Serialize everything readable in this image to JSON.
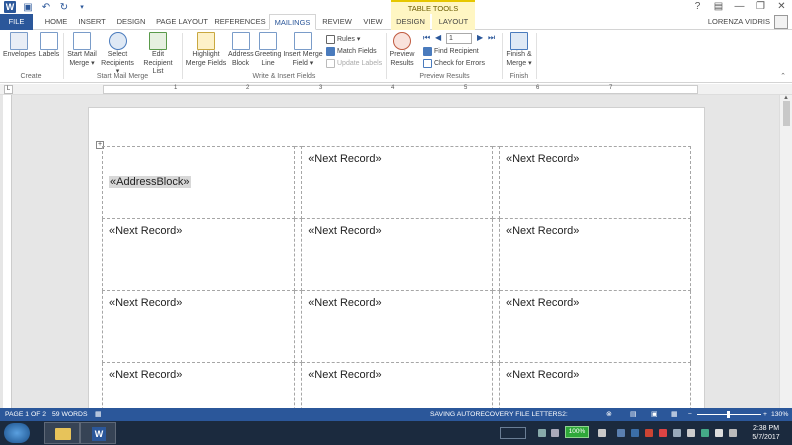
{
  "titlebar": {
    "table_tools_label": "TABLE TOOLS",
    "help_glyph": "?",
    "user_name": "LORENZA VIDRIS"
  },
  "tabs": [
    {
      "label": "FILE"
    },
    {
      "label": "HOME"
    },
    {
      "label": "INSERT"
    },
    {
      "label": "DESIGN"
    },
    {
      "label": "PAGE LAYOUT"
    },
    {
      "label": "REFERENCES"
    },
    {
      "label": "MAILINGS"
    },
    {
      "label": "REVIEW"
    },
    {
      "label": "VIEW"
    },
    {
      "label": "DESIGN"
    },
    {
      "label": "LAYOUT"
    }
  ],
  "ribbon": {
    "create": {
      "envelopes": "Envelopes",
      "labels": "Labels",
      "group": "Create"
    },
    "start_mail_merge": {
      "start_line1": "Start Mail",
      "start_line2": "Merge ▾",
      "select_line1": "Select",
      "select_line2": "Recipients ▾",
      "edit_line1": "Edit",
      "edit_line2": "Recipient List",
      "group": "Start Mail Merge"
    },
    "write_insert": {
      "highlight_line1": "Highlight",
      "highlight_line2": "Merge Fields",
      "address_line1": "Address",
      "address_line2": "Block",
      "greeting_line1": "Greeting",
      "greeting_line2": "Line",
      "insert_line1": "Insert Merge",
      "insert_line2": "Field ▾",
      "rules": "Rules ▾",
      "match_fields": "Match Fields",
      "update_labels": "Update Labels",
      "group": "Write & Insert Fields"
    },
    "preview": {
      "preview_line1": "Preview",
      "preview_line2": "Results",
      "record_value": "1",
      "find_recipient": "Find Recipient",
      "check_errors": "Check for Errors",
      "group": "Preview Results"
    },
    "finish": {
      "finish_line1": "Finish &",
      "finish_line2": "Merge ▾",
      "group": "Finish"
    }
  },
  "ruler": {
    "tab_selector": "L",
    "numbers": [
      "1",
      "2",
      "3",
      "4",
      "5",
      "6",
      "7"
    ]
  },
  "document": {
    "address_block": "«AddressBlock»",
    "next_record": "«Next Record»"
  },
  "status": {
    "page": "PAGE 1 OF 2",
    "words": "59 WORDS",
    "saving": "SAVING AUTORECOVERY FILE LETTERS2:",
    "zoom": "130%"
  },
  "taskbar": {
    "battery": "100%",
    "time": "2:38 PM",
    "date": "5/7/2017"
  },
  "colors": {
    "accent": "#2b579a",
    "table_tools": "#fff6c3",
    "taskbar": "#1b2a3e"
  }
}
